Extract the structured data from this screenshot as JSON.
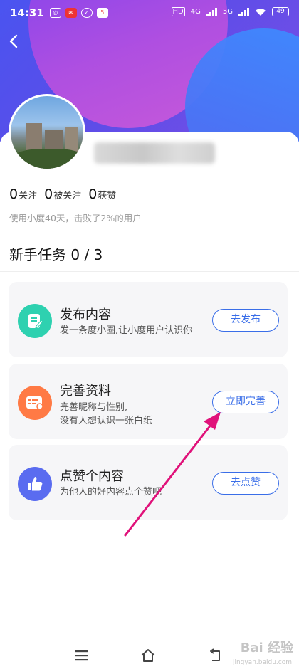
{
  "status_bar": {
    "time": "14:31",
    "battery": "49",
    "network_a": "4G",
    "network_b": "5G",
    "hd_label": "HD"
  },
  "profile": {
    "stats": [
      {
        "count": "0",
        "label": "关注"
      },
      {
        "count": "0",
        "label": "被关注"
      },
      {
        "count": "0",
        "label": "获赞"
      }
    ],
    "usage_text": "使用小度40天，击败了2%的用户"
  },
  "tasks_section": {
    "title": "新手任务 0 / 3"
  },
  "tasks": [
    {
      "name": "发布内容",
      "desc": "发一条度小圈,让小度用户认识你",
      "button": "去发布",
      "icon": "edit-document-icon",
      "color": "#2ed1b0"
    },
    {
      "name": "完善资料",
      "desc_line1": "完善昵称与性别,",
      "desc_line2": "没有人想认识一张白纸",
      "button": "立即完善",
      "icon": "profile-card-icon",
      "color": "#ff7a45"
    },
    {
      "name": "点赞个内容",
      "desc": "为他人的好内容点个赞吧",
      "button": "去点赞",
      "icon": "thumbs-up-icon",
      "color": "#5a6cf0"
    }
  ],
  "watermark": {
    "main": "Bai 经验",
    "sub": "jingyan.baidu.com"
  },
  "colors": {
    "accent": "#3a6ee8",
    "annotation_arrow": "#e0127a"
  }
}
